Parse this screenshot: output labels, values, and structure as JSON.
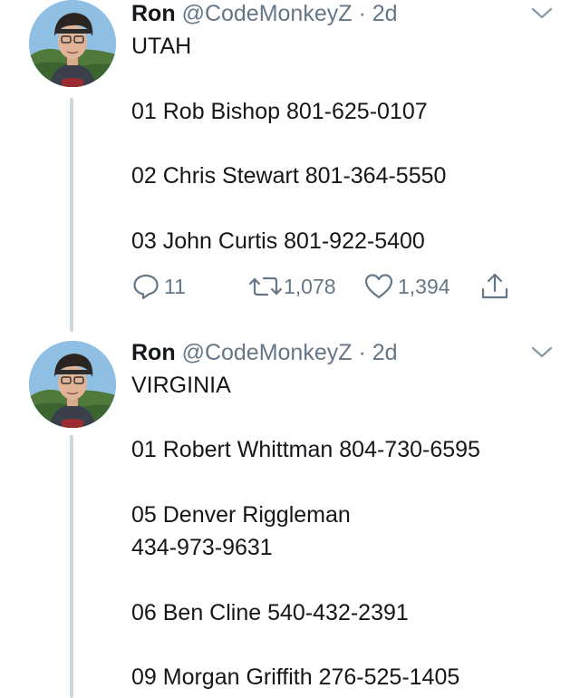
{
  "tweets": [
    {
      "author": {
        "name": "Ron",
        "handle": "@CodeMonkeyZ",
        "separator": "·",
        "age": "2d"
      },
      "lines": [
        "UTAH",
        "01 Rob Bishop 801-625-0107",
        "02 Chris Stewart 801-364-5550",
        "03 John Curtis 801-922-5400"
      ],
      "actions": {
        "replies": "11",
        "retweets": "1,078",
        "likes": "1,394"
      }
    },
    {
      "author": {
        "name": "Ron",
        "handle": "@CodeMonkeyZ",
        "separator": "·",
        "age": "2d"
      },
      "lines": [
        "VIRGINIA",
        "01 Robert Whittman 804-730-6595",
        "05 Denver Riggleman",
        "434-973-9631",
        "06 Ben Cline 540-432-2391",
        "09 Morgan Griffith 276-525-1405"
      ]
    }
  ],
  "icons": {
    "reply": "reply-icon",
    "retweet": "retweet-icon",
    "like": "heart-icon",
    "share": "share-icon",
    "menu": "chevron-down-icon"
  },
  "colors": {
    "text": "#14171a",
    "secondary": "#657786",
    "thread_line": "#ccd6dd"
  }
}
